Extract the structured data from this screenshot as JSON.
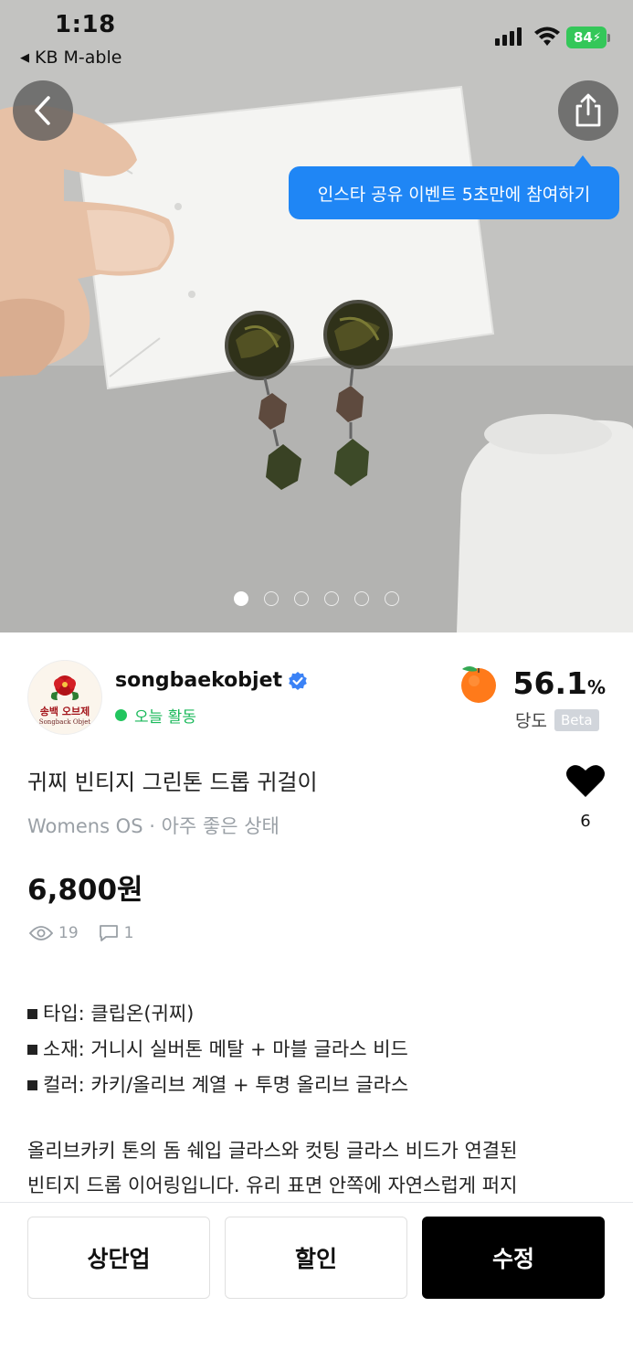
{
  "status_bar": {
    "time": "1:18",
    "back_app": "KB M-able",
    "battery": "84"
  },
  "hero": {
    "tooltip": "인스타 공유 이벤트 5초만에 참여하기",
    "image_count": 6,
    "active_index": 0
  },
  "seller": {
    "name": "songbaekobjet",
    "verified": true,
    "activity": "오늘 활동",
    "avatar_text_kr": "송백 오브제",
    "avatar_text_en": "Songback Objet",
    "score": "56.1",
    "score_unit": "%",
    "score_label": "당도",
    "beta": "Beta"
  },
  "product": {
    "title": "귀찌 빈티지 그린톤 드롭 귀걸이",
    "meta": "Womens OS · 아주 좋은 상태",
    "likes": "6",
    "price": "6,800원",
    "views": "19",
    "comments": "1",
    "specs": [
      "타입: 클립온(귀찌)",
      "소재: 거니시 실버톤 메탈 + 마블 글라스 비드",
      "컬러: 카키/올리브 계열 + 투명 올리브 글라스"
    ],
    "description_lines": [
      "올리브카키 톤의 돔 쉐입 글라스와 컷팅 글라스 비드가 연결된",
      "빈티지 드롭 이어링입니다. 유리 표면 안쪽에 자연스럽게 퍼지"
    ]
  },
  "bottom_bar": {
    "bump_label": "상단업",
    "discount_label": "할인",
    "edit_label": "수정"
  },
  "colors": {
    "tooltip": "#1f86f5",
    "active_green": "#22c55e",
    "verified_blue": "#3b82f6",
    "primary_button": "#000000"
  }
}
